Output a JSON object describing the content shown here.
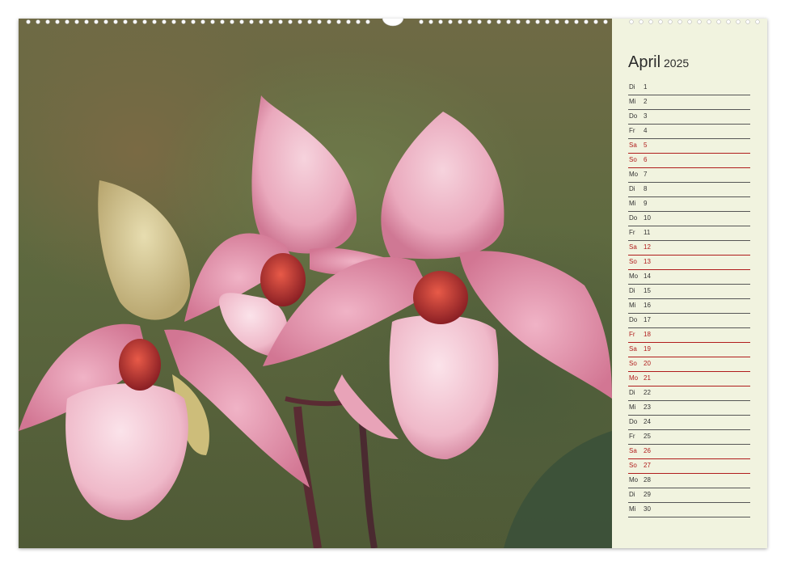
{
  "calendar": {
    "month": "April",
    "year": "2025",
    "days": [
      {
        "weekday": "Di",
        "day": "1",
        "highlight": false
      },
      {
        "weekday": "Mi",
        "day": "2",
        "highlight": false
      },
      {
        "weekday": "Do",
        "day": "3",
        "highlight": false
      },
      {
        "weekday": "Fr",
        "day": "4",
        "highlight": false
      },
      {
        "weekday": "Sa",
        "day": "5",
        "highlight": true
      },
      {
        "weekday": "So",
        "day": "6",
        "highlight": true
      },
      {
        "weekday": "Mo",
        "day": "7",
        "highlight": false
      },
      {
        "weekday": "Di",
        "day": "8",
        "highlight": false
      },
      {
        "weekday": "Mi",
        "day": "9",
        "highlight": false
      },
      {
        "weekday": "Do",
        "day": "10",
        "highlight": false
      },
      {
        "weekday": "Fr",
        "day": "11",
        "highlight": false
      },
      {
        "weekday": "Sa",
        "day": "12",
        "highlight": true
      },
      {
        "weekday": "So",
        "day": "13",
        "highlight": true
      },
      {
        "weekday": "Mo",
        "day": "14",
        "highlight": false
      },
      {
        "weekday": "Di",
        "day": "15",
        "highlight": false
      },
      {
        "weekday": "Mi",
        "day": "16",
        "highlight": false
      },
      {
        "weekday": "Do",
        "day": "17",
        "highlight": false
      },
      {
        "weekday": "Fr",
        "day": "18",
        "highlight": true
      },
      {
        "weekday": "Sa",
        "day": "19",
        "highlight": true
      },
      {
        "weekday": "So",
        "day": "20",
        "highlight": true
      },
      {
        "weekday": "Mo",
        "day": "21",
        "highlight": true
      },
      {
        "weekday": "Di",
        "day": "22",
        "highlight": false
      },
      {
        "weekday": "Mi",
        "day": "23",
        "highlight": false
      },
      {
        "weekday": "Do",
        "day": "24",
        "highlight": false
      },
      {
        "weekday": "Fr",
        "day": "25",
        "highlight": false
      },
      {
        "weekday": "Sa",
        "day": "26",
        "highlight": true
      },
      {
        "weekday": "So",
        "day": "27",
        "highlight": true
      },
      {
        "weekday": "Mo",
        "day": "28",
        "highlight": false
      },
      {
        "weekday": "Di",
        "day": "29",
        "highlight": false
      },
      {
        "weekday": "Mi",
        "day": "30",
        "highlight": false
      }
    ]
  },
  "colors": {
    "holiday": "#b01c1c",
    "panel": "#f1f3df",
    "petal": "#e59ab2"
  },
  "photo": {
    "subject_icon": "orchid-flowers-photo"
  }
}
